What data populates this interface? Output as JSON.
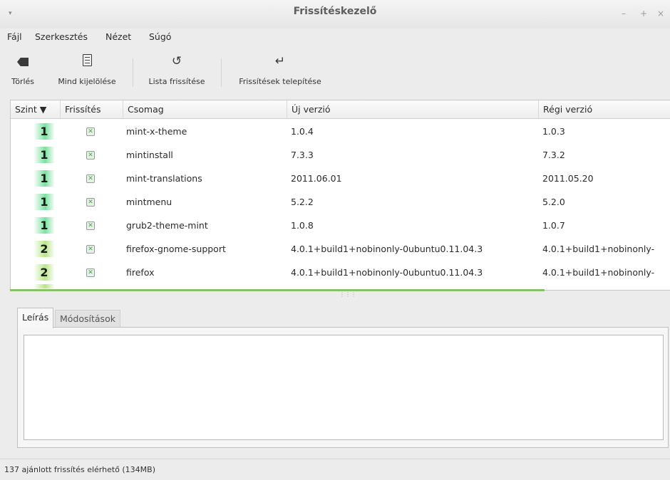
{
  "window": {
    "title": "Frissítéskezelő",
    "controls": {
      "minimize": "–",
      "maximize": "+",
      "close": "×"
    },
    "menu_glyph": "▾"
  },
  "menubar": [
    {
      "label": "Fájl"
    },
    {
      "label": "Szerkesztés"
    },
    {
      "label": "Nézet"
    },
    {
      "label": "Súgó"
    }
  ],
  "toolbar": [
    {
      "label": "Törlés",
      "icon": "clear-icon"
    },
    {
      "label": "Mind kijelölése",
      "icon": "select-all-icon"
    },
    {
      "label": "Lista frissítése",
      "icon": "refresh-icon",
      "glyph": "↺"
    },
    {
      "label": "Frissítések telepítése",
      "icon": "install-icon",
      "glyph": "↵"
    }
  ],
  "table": {
    "headers": [
      "Szint ▼",
      "Frissítés",
      "Csomag",
      "Új verzió",
      "Régi verzió"
    ],
    "rows": [
      {
        "level": "1",
        "package": "mint-x-theme",
        "new_version": "1.0.4",
        "old_version": "1.0.3"
      },
      {
        "level": "1",
        "package": "mintinstall",
        "new_version": "7.3.3",
        "old_version": "7.3.2"
      },
      {
        "level": "1",
        "package": "mint-translations",
        "new_version": "2011.06.01",
        "old_version": "2011.05.20"
      },
      {
        "level": "1",
        "package": "mintmenu",
        "new_version": "5.2.2",
        "old_version": "5.2.0"
      },
      {
        "level": "1",
        "package": "grub2-theme-mint",
        "new_version": "1.0.8",
        "old_version": "1.0.7"
      },
      {
        "level": "2",
        "package": "firefox-gnome-support",
        "new_version": "4.0.1+build1+nobinonly-0ubuntu0.11.04.3",
        "old_version": "4.0.1+build1+nobinonly-"
      },
      {
        "level": "2",
        "package": "firefox",
        "new_version": "4.0.1+build1+nobinonly-0ubuntu0.11.04.3",
        "old_version": "4.0.1+build1+nobinonly-"
      }
    ],
    "checkbox_glyph": "✕"
  },
  "tabs": [
    {
      "label": "Leírás"
    },
    {
      "label": "Módosítások"
    }
  ],
  "description": "",
  "status": "137 ajánlott frissítés elérhető (134MB)"
}
